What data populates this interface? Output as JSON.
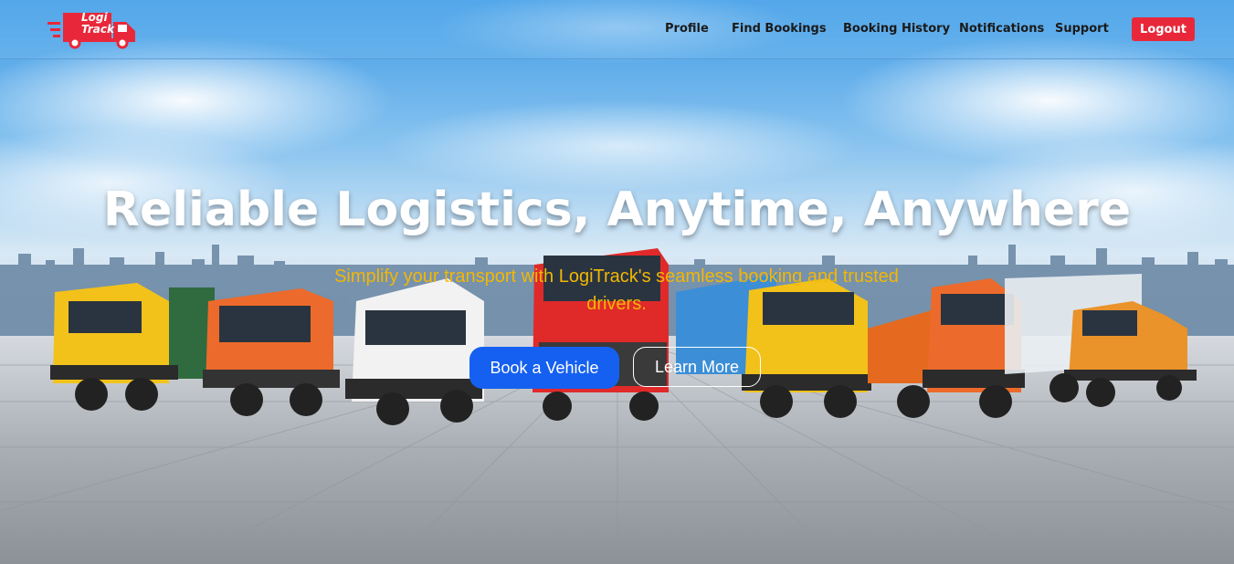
{
  "brand": {
    "logo_line1": "Logi",
    "logo_line2": "Track",
    "logo_icon": "delivery-truck-icon",
    "logo_color": "#e8283a"
  },
  "nav": {
    "items": [
      {
        "label": "Profile"
      },
      {
        "label": "Find Bookings"
      },
      {
        "label": "Booking History"
      },
      {
        "label": "Notifications"
      },
      {
        "label": "Support"
      }
    ],
    "logout_label": "Logout"
  },
  "hero": {
    "title": "Reliable Logistics, Anytime, Anywhere",
    "subtitle": "Simplify your transport with LogiTrack's seamless booking and trusted drivers.",
    "primary_button": "Book a Vehicle",
    "secondary_button": "Learn More"
  },
  "colors": {
    "accent_red": "#e8283a",
    "primary_blue": "#1560f0",
    "subtitle_yellow": "#f2b705"
  }
}
